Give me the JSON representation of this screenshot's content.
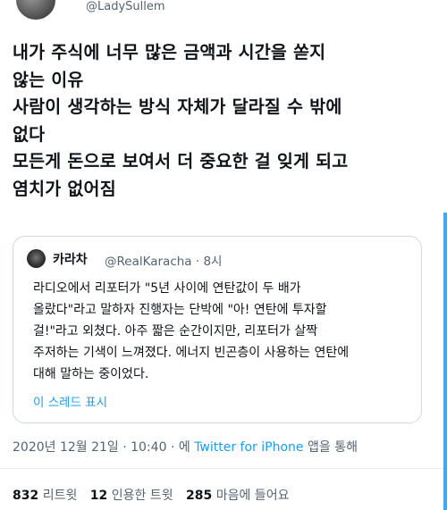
{
  "author": {
    "handle": "@LadySullem"
  },
  "tweet": {
    "lines": [
      "내가 주식에 너무 많은 금액과 시간을 쏟지",
      "않는 이유",
      "사람이 생각하는 방식 자체가 달라질 수 밖에",
      "없다",
      "모든게 돈으로 보여서 더 중요한 걸 잊게 되고",
      "염치가 없어짐"
    ]
  },
  "quote": {
    "name": "카라차",
    "handle": "@RealKaracha",
    "separator": "·",
    "time": "8시",
    "lines": [
      "라디오에서 리포터가 \"5년 사이에 연탄값이 두 배가",
      "올랐다\"라고 말하자 진행자는 단박에 \"아! 연탄에 투자할",
      "걸!\"라고 외쳤다. 아주 짧은 순간이지만, 리포터가 살짝",
      "주저하는 기색이 느껴졌다. 에너지 빈곤층이 사용하는 연탄에",
      "대해 말하는 중이었다."
    ],
    "thread_link": "이 스레드 표시"
  },
  "meta": {
    "timestamp": "2020년 12월 21일 · 10:40 · 에",
    "source": "Twitter for iPhone",
    "via": "앱을 통해"
  },
  "stats": {
    "retweets": {
      "count": "832",
      "label": "리트윗"
    },
    "quotes": {
      "count": "12",
      "label": "인용한 트윗"
    },
    "likes": {
      "count": "285",
      "label": "마음에 들어요"
    }
  },
  "colors": {
    "link": "#1d9bf0",
    "muted": "#536471",
    "text": "#0f1419",
    "border": "#cfd9de"
  }
}
